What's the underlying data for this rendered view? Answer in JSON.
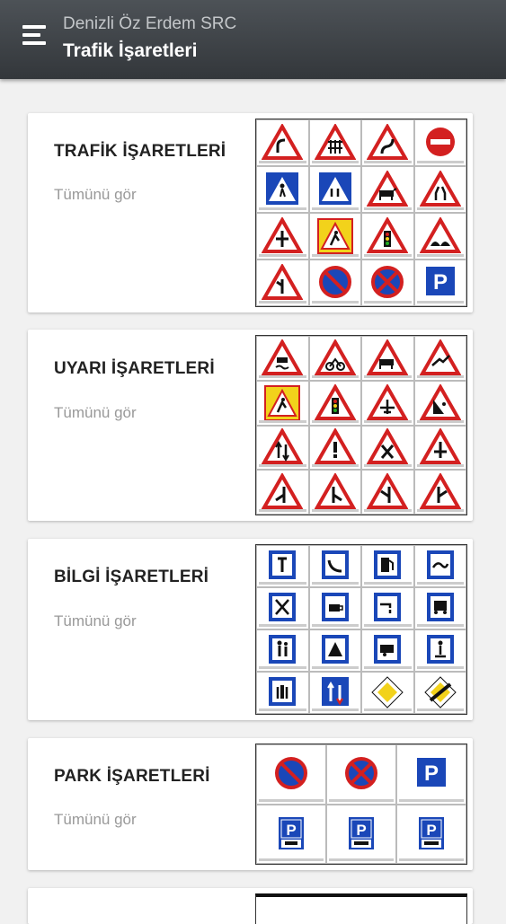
{
  "header": {
    "subtitle": "Denizli Öz Erdem SRC",
    "title": "Trafik İşaretleri"
  },
  "categories": [
    {
      "title": "TRAFİK İŞARETLERİ",
      "link": "Tümünü gör"
    },
    {
      "title": "UYARI İŞARETLERİ",
      "link": "Tümünü gör"
    },
    {
      "title": "BİLGİ İŞARETLERİ",
      "link": "Tümünü gör"
    },
    {
      "title": "PARK İŞARETLERİ",
      "link": "Tümünü gör"
    }
  ],
  "colors": {
    "header_bg": "#3e4246",
    "warning_red": "#d32020",
    "info_blue": "#1a47b8",
    "priority_yellow": "#f2d21b"
  }
}
